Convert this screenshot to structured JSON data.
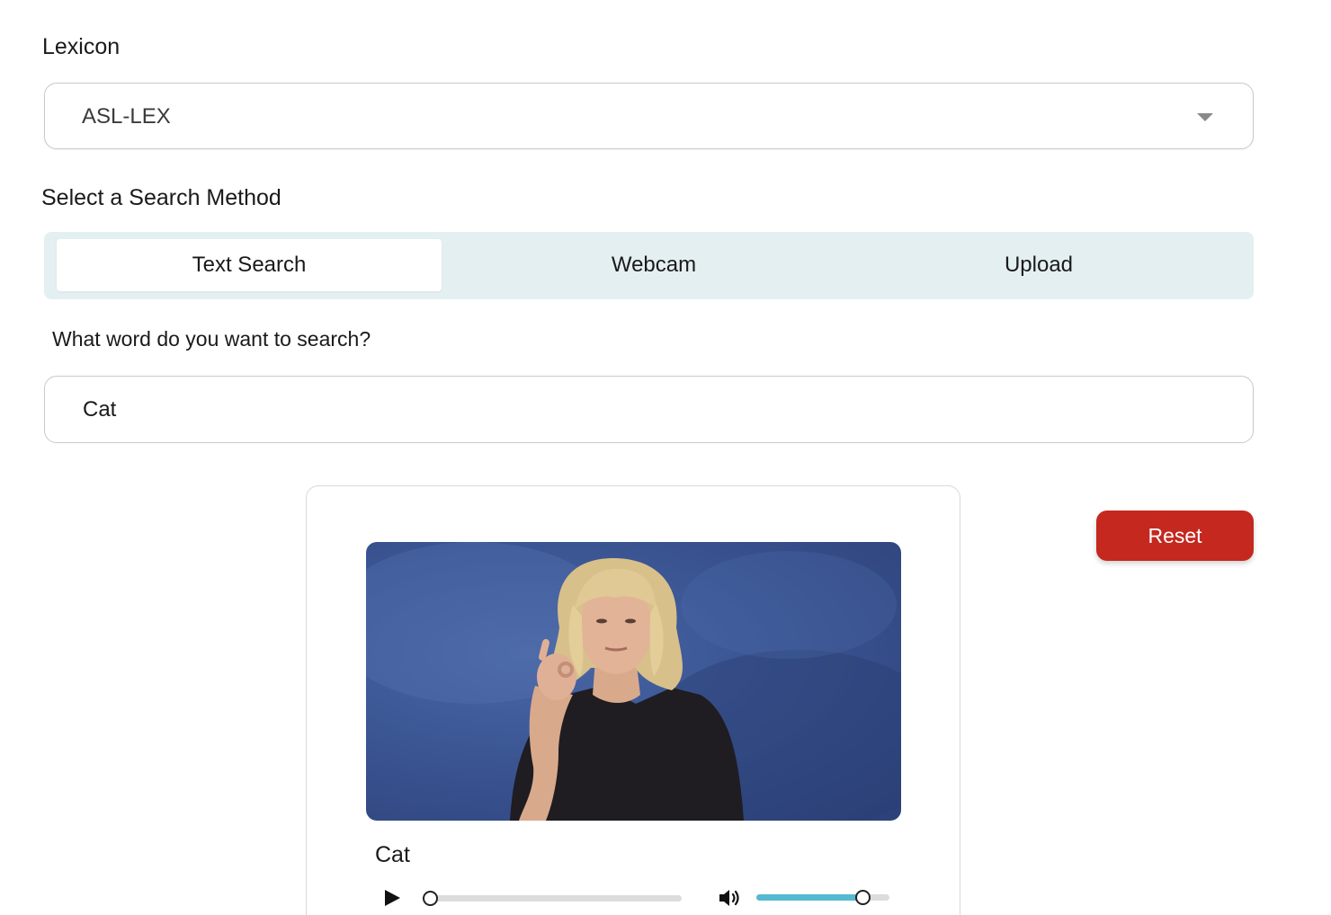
{
  "lexicon": {
    "label": "Lexicon",
    "selected": "ASL-LEX"
  },
  "search_method": {
    "label": "Select a Search Method",
    "tabs": [
      {
        "label": "Text Search",
        "active": true
      },
      {
        "label": "Webcam",
        "active": false
      },
      {
        "label": "Upload",
        "active": false
      }
    ]
  },
  "text_search": {
    "question": "What word do you want to search?",
    "value": "Cat"
  },
  "result": {
    "word": "Cat",
    "playback_progress": 0.0,
    "volume_level": 0.82
  },
  "reset_label": "Reset",
  "colors": {
    "accent": "#c4281f",
    "tab_bg": "#e4eff1",
    "volume": "#56b9d2"
  },
  "icons": {
    "dropdown": "chevron-down-icon",
    "play": "play-icon",
    "volume": "volume-icon"
  }
}
